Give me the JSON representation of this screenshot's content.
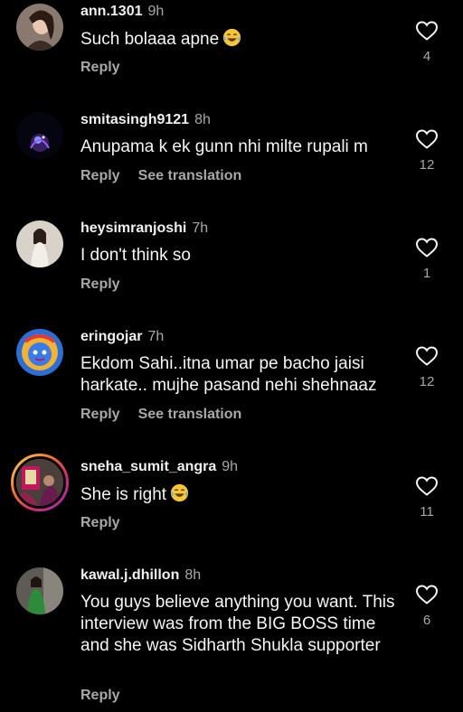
{
  "comments": [
    {
      "username": "ann.1301",
      "time": "9h",
      "text": "Such bolaaa apne",
      "emoji": "tears-of-joy-emoji",
      "reply": "Reply",
      "likes": "4"
    },
    {
      "username": "smitasingh9121",
      "time": "8h",
      "text": "Anupama k ek gunn nhi milte rupali m",
      "reply": "Reply",
      "translate": "See translation",
      "likes": "12"
    },
    {
      "username": "heysimranjoshi",
      "time": "7h",
      "text": "I don't think so",
      "reply": "Reply",
      "likes": "1"
    },
    {
      "username": "eringojar",
      "time": "7h",
      "text": "Ekdom Sahi..itna umar pe bacho jaisi harkate.. mujhe pasand nehi shehnaaz",
      "reply": "Reply",
      "translate": "See translation",
      "likes": "12"
    },
    {
      "username": "sneha_sumit_angra",
      "time": "9h",
      "text": "She is right",
      "emoji": "tears-of-joy-emoji",
      "reply": "Reply",
      "likes": "11"
    },
    {
      "username": "kawal.j.dhillon",
      "time": "8h",
      "text": "You guys believe anything you want. This interview was from the BIG BOSS time and she was Sidharth Shukla supporter",
      "reply": "Reply",
      "likes": "6"
    }
  ],
  "colors": {
    "background": "#000000",
    "primary_text": "#f5f5f5",
    "secondary_text": "#a8a8a8",
    "story_ring": [
      "#feda75",
      "#fa7e1e",
      "#d62976",
      "#962fbf"
    ]
  },
  "icons": {
    "like": "heart-outline-icon"
  }
}
